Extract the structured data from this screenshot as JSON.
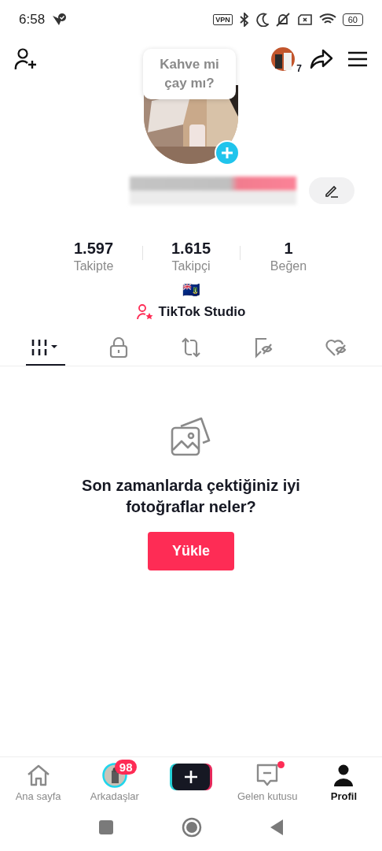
{
  "status_bar": {
    "time": "6:58",
    "vpn": "VPN",
    "battery": "60"
  },
  "header": {
    "story_count": "7"
  },
  "bubble": {
    "text": "Kahve mi çay mı?"
  },
  "stats": [
    {
      "value": "1.597",
      "label": "Takipte"
    },
    {
      "value": "1.615",
      "label": "Takipçi"
    },
    {
      "value": "1",
      "label": "Beğen"
    }
  ],
  "flag": "🇻🇬",
  "studio_link": "TikTok Studio",
  "tabs": [
    {
      "kind": "grid",
      "selected": true
    },
    {
      "kind": "lock",
      "selected": false
    },
    {
      "kind": "repost",
      "selected": false
    },
    {
      "kind": "saved",
      "selected": false
    },
    {
      "kind": "liked",
      "selected": false
    }
  ],
  "empty_state": {
    "message": "Son zamanlarda çektiğiniz iyi fotoğraflar neler?",
    "button": "Yükle"
  },
  "bottom_nav": [
    {
      "kind": "home",
      "label": "Ana sayfa",
      "selected": false
    },
    {
      "kind": "friends",
      "label": "Arkadaşlar",
      "badge": "98",
      "selected": false
    },
    {
      "kind": "create"
    },
    {
      "kind": "inbox",
      "label": "Gelen kutusu",
      "dot": true,
      "selected": false
    },
    {
      "kind": "profile",
      "label": "Profil",
      "selected": true
    }
  ]
}
